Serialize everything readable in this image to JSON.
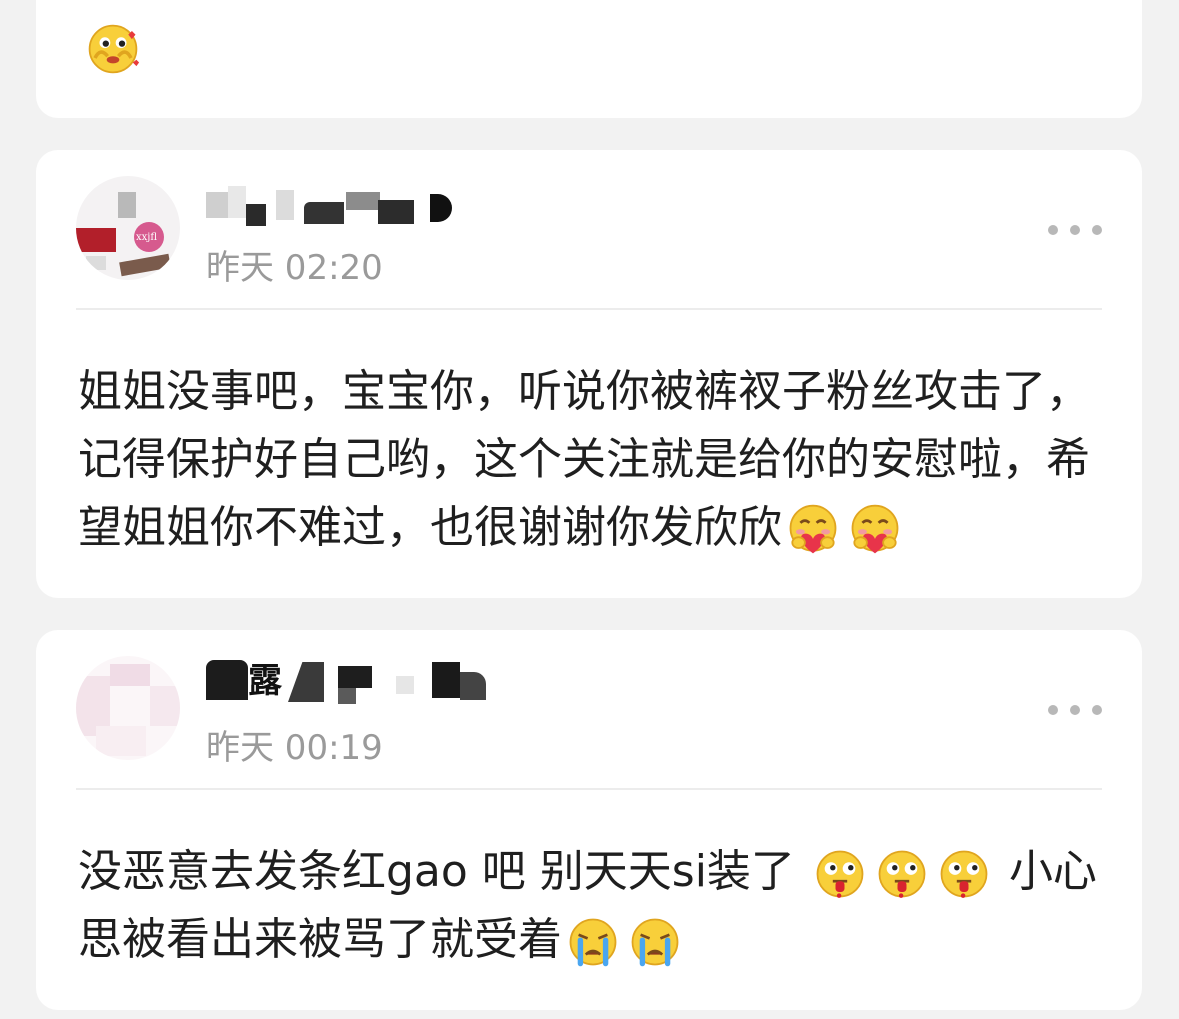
{
  "top_card": {
    "emojis": [
      "shy-face-emoji"
    ]
  },
  "comments": [
    {
      "author": "",
      "time": "昨天 02:20",
      "more": "more-options",
      "avatar_text": "xxjfl",
      "segments": [
        "姐姐没事吧，宝宝你，听说你被裤衩子粉丝攻击了，记得保护好自己哟，这个关注就是给你的安慰啦，希望姐姐你不难过，也很谢谢你发欣欣"
      ],
      "emojis": [
        "hug-heart-face-emoji",
        "hug-heart-face-emoji"
      ]
    },
    {
      "author": "露",
      "time": "昨天 00:19",
      "more": "more-options",
      "segments": [
        "没恶意去发条红gao 吧 别天天si装了",
        "小心思被看出来被骂了就受着"
      ],
      "emojis": [
        "tongue-face-emoji",
        "tongue-face-emoji",
        "tongue-face-emoji",
        "crying-face-emoji",
        "crying-face-emoji"
      ]
    }
  ],
  "colors": {
    "background": "#f2f2f2",
    "card": "#ffffff",
    "time": "#9a9a9a",
    "more_dots": "#b8b8b8"
  }
}
